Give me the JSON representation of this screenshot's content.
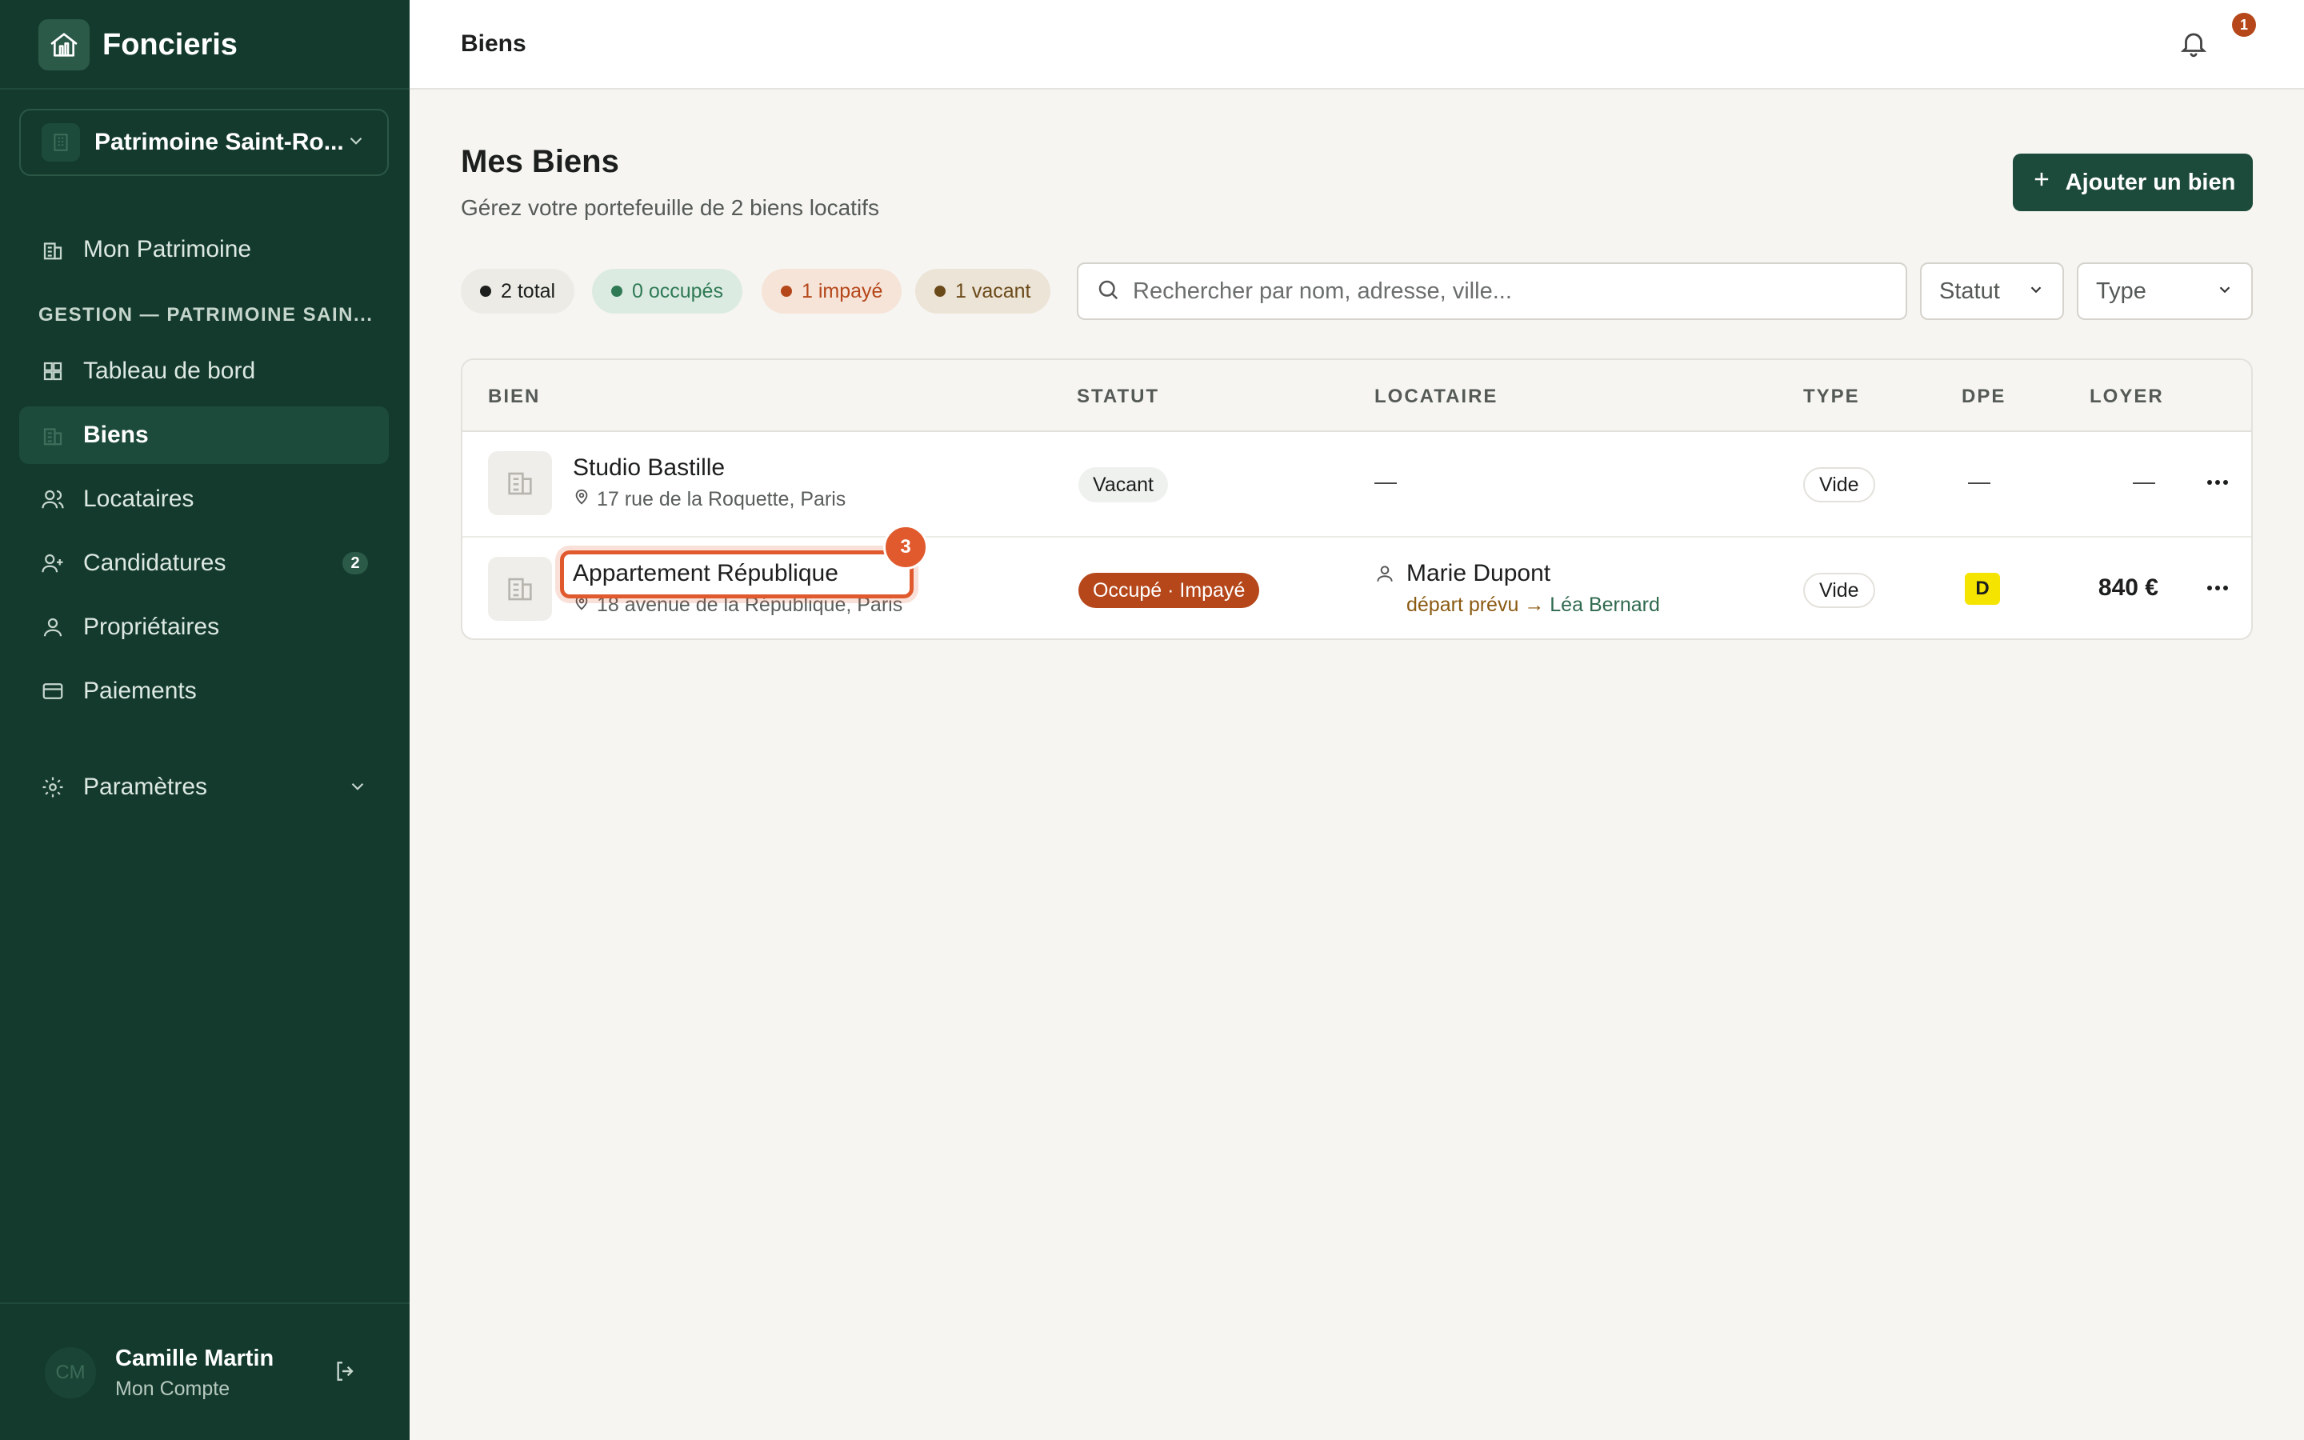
{
  "app": {
    "name": "Foncieris"
  },
  "workspace": {
    "name": "Patrimoine Saint-Ro..."
  },
  "sidebar": {
    "top_item": "Mon Patrimoine",
    "section_title": "GESTION — PATRIMOINE SAIN...",
    "items": [
      {
        "label": "Tableau de bord",
        "icon": "dashboard-icon"
      },
      {
        "label": "Biens",
        "icon": "building-icon",
        "active": true
      },
      {
        "label": "Locataires",
        "icon": "users-icon"
      },
      {
        "label": "Candidatures",
        "icon": "user-plus-icon",
        "badge": "2"
      },
      {
        "label": "Propriétaires",
        "icon": "user-icon"
      },
      {
        "label": "Paiements",
        "icon": "credit-card-icon"
      }
    ],
    "settings": "Paramètres"
  },
  "user": {
    "initials": "CM",
    "name": "Camille Martin",
    "subtitle": "Mon Compte"
  },
  "topbar": {
    "title": "Biens",
    "notifications": "1"
  },
  "page": {
    "title": "Mes Biens",
    "subtitle": "Gérez votre portefeuille de 2 biens locatifs",
    "add_button": "Ajouter un bien"
  },
  "filters": {
    "chips": [
      {
        "label": "2 total",
        "color": "#1c1f1d"
      },
      {
        "label": "0 occupés",
        "color": "#2f7a55"
      },
      {
        "label": "1 impayé",
        "color": "#b5471a"
      },
      {
        "label": "1 vacant",
        "color": "#6b4a1a"
      }
    ],
    "search_placeholder": "Rechercher par nom, adresse, ville...",
    "status_select": "Statut",
    "type_select": "Type"
  },
  "table": {
    "headers": [
      "BIEN",
      "STATUT",
      "LOCATAIRE",
      "TYPE",
      "DPE",
      "LOYER"
    ],
    "rows": [
      {
        "name": "Studio Bastille",
        "address": "17 rue de la Roquette, Paris",
        "status": "Vacant",
        "tenant": "—",
        "type": "Vide",
        "dpe": "—",
        "rent": "—"
      },
      {
        "name": "Appartement République",
        "address": "18 avenue de la République, Paris",
        "status": "Occupé · Impayé",
        "tenant": "Marie Dupont",
        "tenant_note_prefix": "départ prévu →",
        "tenant_note_name": "Léa Bernard",
        "type": "Vide",
        "dpe": "D",
        "rent": "840 €"
      }
    ]
  },
  "annotation": {
    "badge": "3"
  },
  "colors": {
    "sidebar": "#133a2d",
    "accent": "#1d4b3b",
    "unpaid": "#b5471a",
    "dpe_d": "#f5e400"
  }
}
